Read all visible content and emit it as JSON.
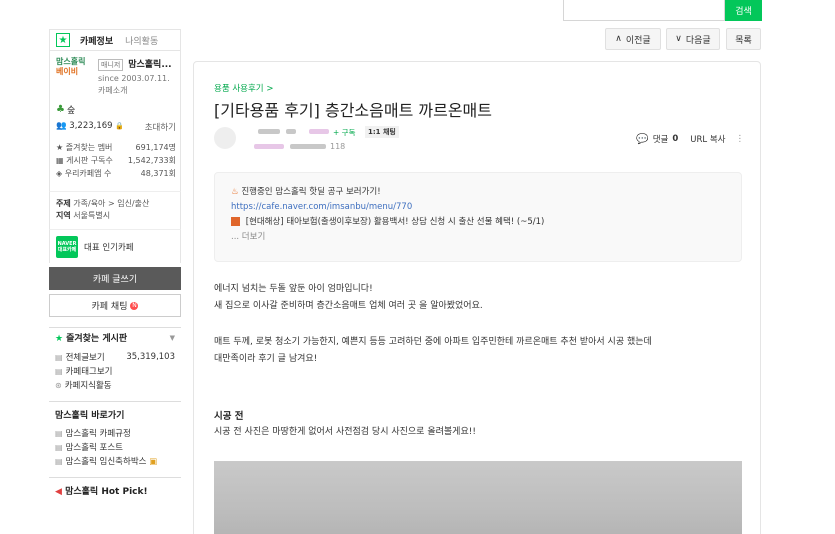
{
  "search": {
    "button_label": "검색"
  },
  "sidebar": {
    "tabs": {
      "active": "카페정보",
      "other": "나의활동"
    },
    "cafe": {
      "logo_line1": "맘스홀릭",
      "logo_line2": "베이비",
      "manager_badge": "매니저",
      "name": "맘스홀릭...",
      "since": "since 2003.07.11.",
      "intro": "카페소개"
    },
    "grade": "숲",
    "members": "3,223,169",
    "invite": "초대하기",
    "stats": [
      {
        "label": "즐겨찾는 멤버",
        "value": "691,174명"
      },
      {
        "label": "게시판 구독수",
        "value": "1,542,733회"
      },
      {
        "label": "우리카페앱 수",
        "value": "48,371회"
      }
    ],
    "topic": {
      "label": "주제",
      "value": "가족/육아 > 임신/출산",
      "region_label": "지역",
      "region_value": "서울특별시"
    },
    "naver_badge": {
      "line1": "NAVER",
      "line2": "대표카페"
    },
    "naver_text": "대표 인기카페",
    "write_button": "카페 글쓰기",
    "chat_button": "카페 채팅",
    "chat_dot": "N",
    "fav_header": "즐겨찾는 게시판",
    "fav_items": [
      {
        "label": "전체글보기",
        "count": "35,319,103"
      },
      {
        "label": "카페태그보기",
        "count": ""
      },
      {
        "label": "카페지식활동",
        "count": ""
      }
    ],
    "shortcut_header": "맘스홀릭 바로가기",
    "shortcut_items": [
      {
        "label": "맘스홀릭 카페규정"
      },
      {
        "label": "맘스홀릭 포스트"
      },
      {
        "label": "맘스홀릭 임신축하박스"
      }
    ],
    "hotpick_header": "맘스홀릭 Hot Pick!"
  },
  "nav": {
    "prev": "이전글",
    "next": "다음글",
    "list": "목록"
  },
  "article": {
    "breadcrumb": "용품 사용후기 >",
    "title": "[기타용품 후기] 층간소음매트 까르온매트",
    "subscribe": "+ 구독",
    "chat_tag": "1:1 채팅",
    "views_suffix": "118",
    "comment_label": "댓글",
    "comment_count": "0",
    "url_copy": "URL 복사",
    "notice": {
      "line1": "진행중인 맘스홀릭 핫딜 공구 보러가기!",
      "link": "https://cafe.naver.com/imsanbu/menu/770",
      "line2": "[현대해상] 태아보험(출생이후보장) 활용백서! 상담 신청 시 출산 선물 혜택! (~5/1)",
      "more": "... 더보기"
    },
    "paragraphs": [
      "에너지 넘치는 두돌 앞둔 아이 엄마입니다!",
      "새 집으로 이사갈 준비하며 층간소음매트 업체 여러 곳 을 알아봤었어요.",
      "매트 두께, 로봇 청소기 가능한지, 예쁜지 등등 고려하던 중에 아파트 입주민한테 까르온매트 추천 받아서 시공 했는데",
      "대만족이라 후기 글 남겨요!"
    ],
    "section_title": "시공 전",
    "section_text": "시공 전 사진은 마땅한게 없어서 사전점검 당시 사진으로 올려볼게요!!"
  }
}
